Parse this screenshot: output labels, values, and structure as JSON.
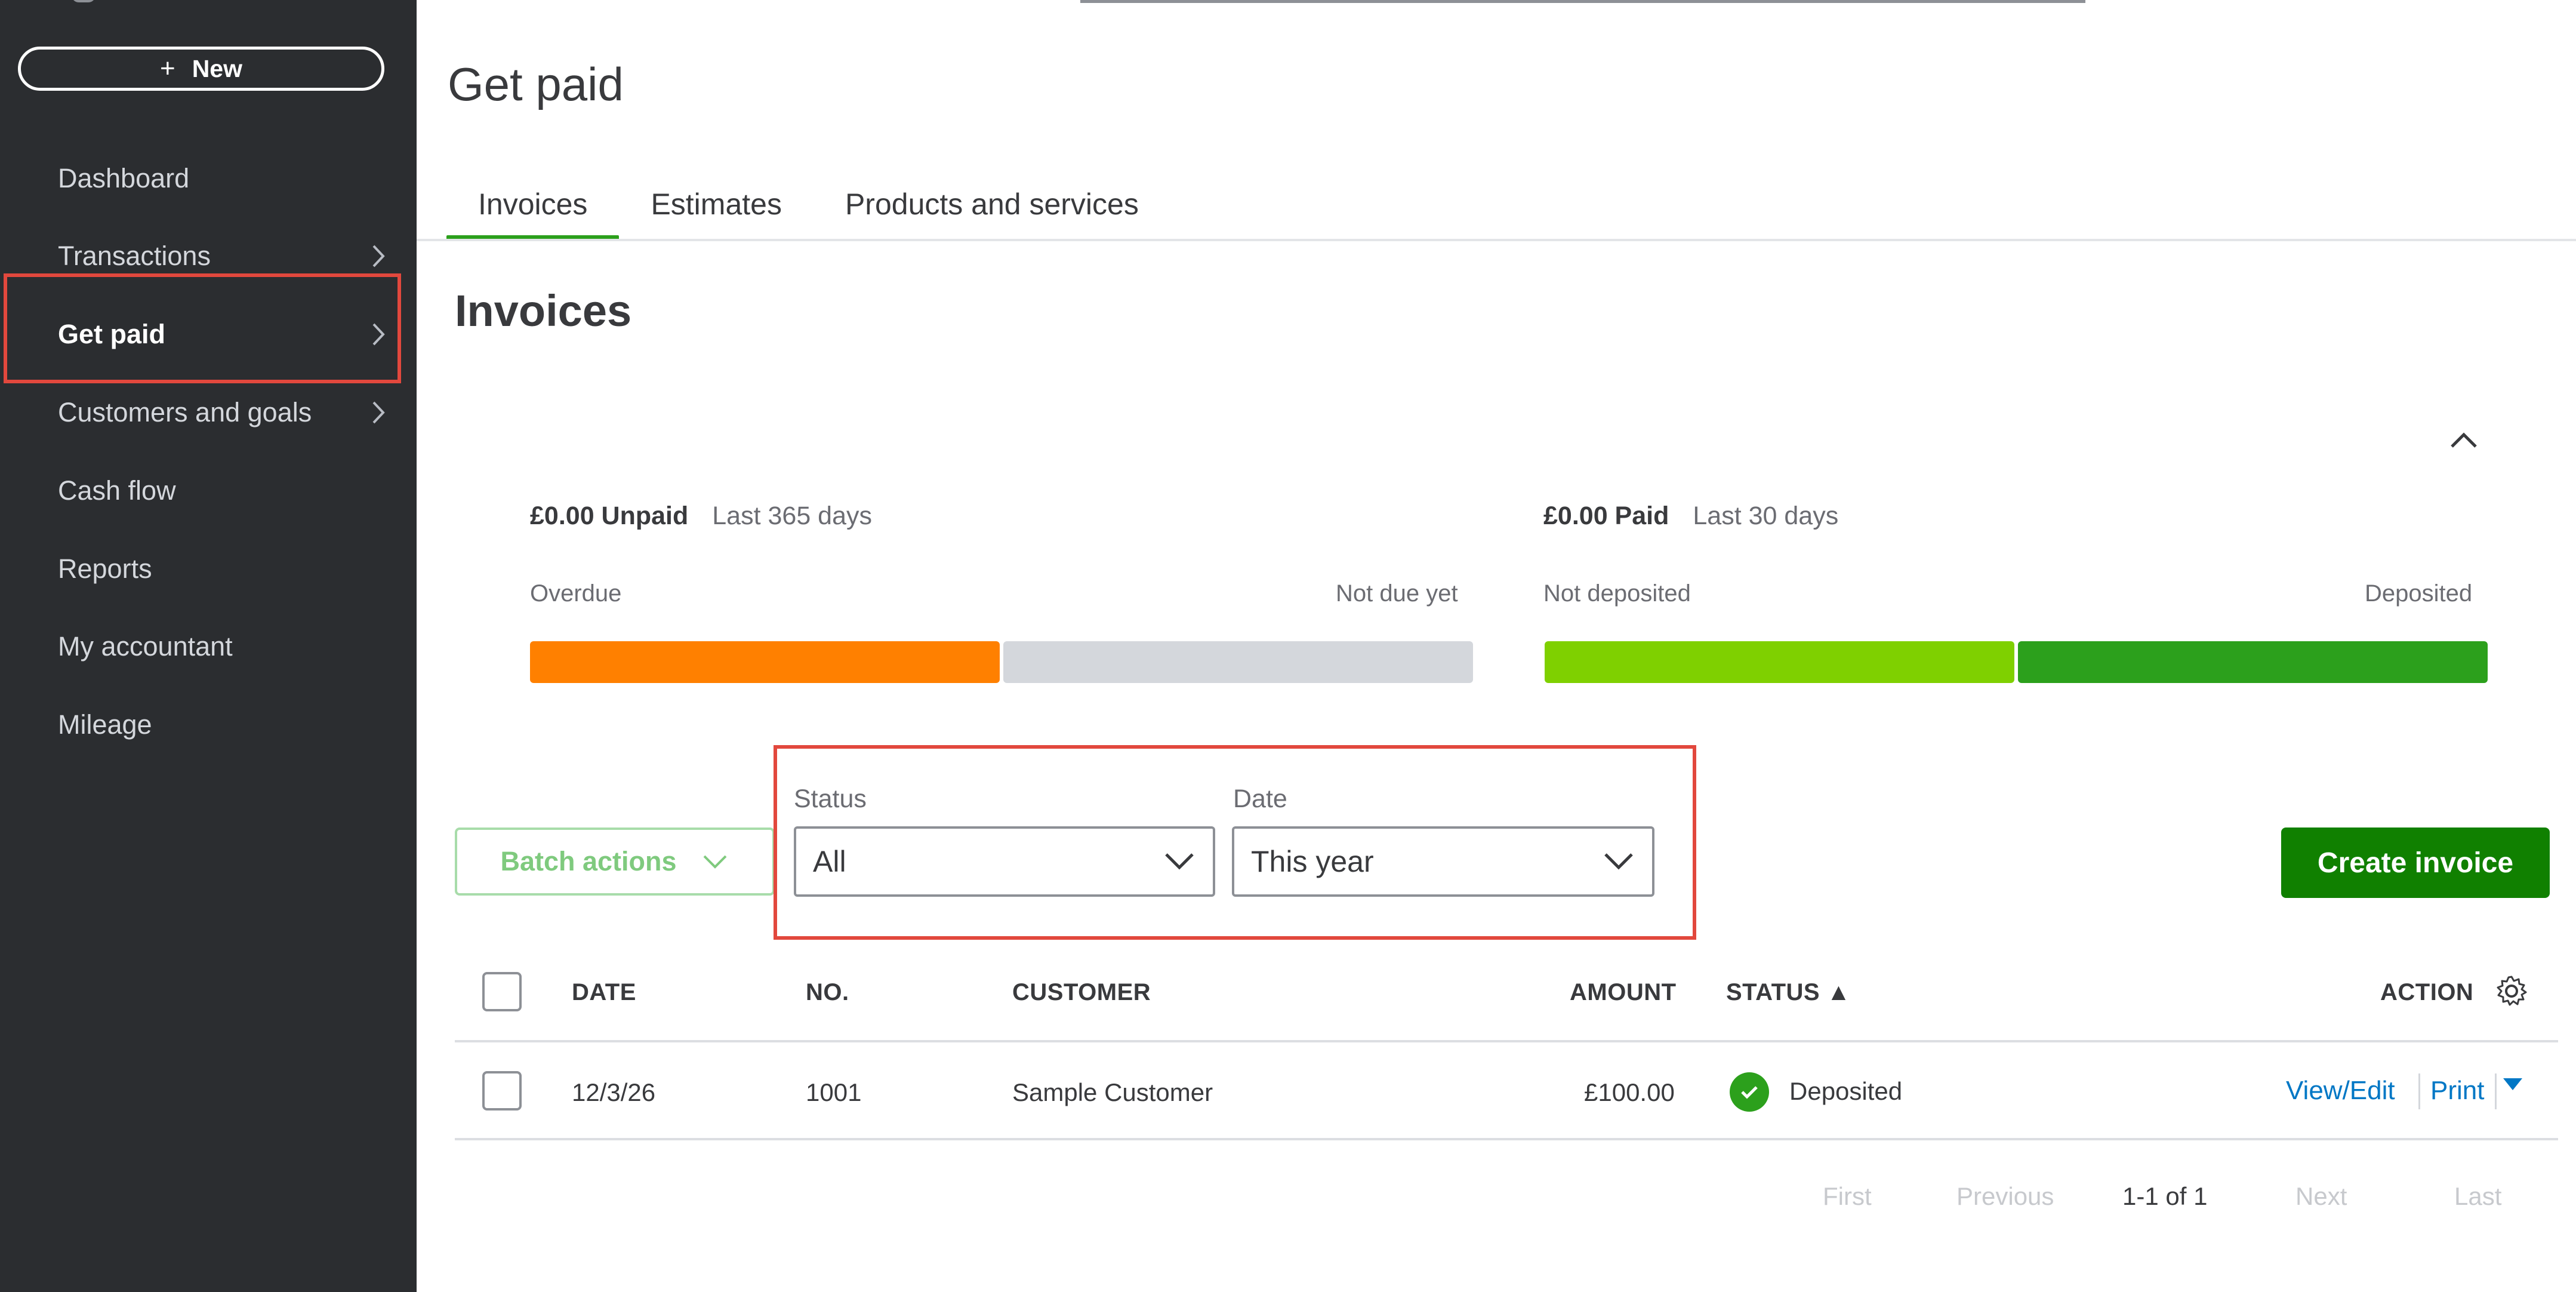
{
  "sidebar": {
    "new_label": "New",
    "new_plus": "+",
    "items": [
      {
        "label": "Dashboard",
        "has_chevron": false
      },
      {
        "label": "Transactions",
        "has_chevron": true
      },
      {
        "label": "Get paid",
        "has_chevron": true,
        "active": true
      },
      {
        "label": "Customers and goals",
        "has_chevron": true
      },
      {
        "label": "Cash flow",
        "has_chevron": false
      },
      {
        "label": "Reports",
        "has_chevron": false
      },
      {
        "label": "My accountant",
        "has_chevron": false
      },
      {
        "label": "Mileage",
        "has_chevron": false
      }
    ]
  },
  "header": {
    "title": "Get paid",
    "tabs": [
      {
        "label": "Invoices",
        "active": true
      },
      {
        "label": "Estimates",
        "active": false
      },
      {
        "label": "Products and services",
        "active": false
      }
    ]
  },
  "invoices": {
    "section_title": "Invoices",
    "unpaid": {
      "amount": "£0.00 Unpaid",
      "period": "Last 365 days",
      "left_label": "Overdue",
      "right_label": "Not due yet",
      "left_fraction": 0.5,
      "left_color": "#ff8000",
      "right_color": "#d4d7dc"
    },
    "paid": {
      "amount": "£0.00 Paid",
      "period": "Last 30 days",
      "left_label": "Not deposited",
      "right_label": "Deposited",
      "left_fraction": 0.5,
      "left_color": "#7fd000",
      "right_color": "#2ca01c"
    }
  },
  "filters": {
    "batch_actions": "Batch actions",
    "status_label": "Status",
    "status_value": "All",
    "date_label": "Date",
    "date_value": "This year",
    "create_invoice": "Create invoice"
  },
  "table": {
    "columns": {
      "date": "DATE",
      "no": "NO.",
      "customer": "CUSTOMER",
      "amount": "AMOUNT",
      "status": "STATUS ▲",
      "action": "ACTION"
    },
    "rows": [
      {
        "date": "12/3/26",
        "no": "1001",
        "customer": "Sample Customer",
        "amount": "£100.00",
        "status": "Deposited",
        "action_primary": "View/Edit",
        "action_secondary": "Print"
      }
    ]
  },
  "pagination": {
    "first": "First",
    "previous": "Previous",
    "range": "1-1 of 1",
    "next": "Next",
    "last": "Last"
  },
  "colors": {
    "accent_green": "#2ca01c",
    "button_green": "#108000",
    "link_blue": "#0077c5",
    "highlight_red": "#e2483d",
    "sidebar_bg": "#2b2d30"
  }
}
